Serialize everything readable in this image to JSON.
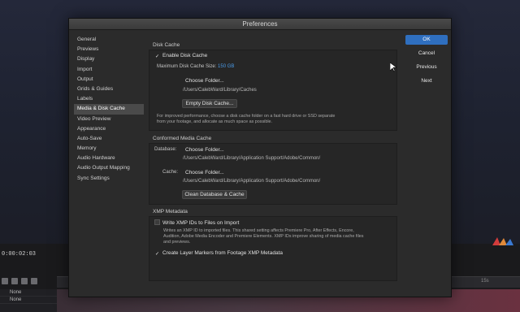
{
  "dialog": {
    "title": "Preferences"
  },
  "sidebar": {
    "items": [
      {
        "label": "General"
      },
      {
        "label": "Previews"
      },
      {
        "label": "Display"
      },
      {
        "label": "Import"
      },
      {
        "label": "Output"
      },
      {
        "label": "Grids & Guides"
      },
      {
        "label": "Labels"
      },
      {
        "label": "Media & Disk Cache"
      },
      {
        "label": "Video Preview"
      },
      {
        "label": "Appearance"
      },
      {
        "label": "Auto-Save"
      },
      {
        "label": "Memory"
      },
      {
        "label": "Audio Hardware"
      },
      {
        "label": "Audio Output Mapping"
      },
      {
        "label": "Sync Settings"
      }
    ],
    "active_index": 7
  },
  "disk_cache": {
    "title": "Disk Cache",
    "enable_label": "Enable Disk Cache",
    "max_size_label": "Maximum Disk Cache Size:",
    "max_size_value": "150 GB",
    "choose_folder": "Choose Folder...",
    "path": "/Users/CalebWard/Library/Caches",
    "empty_button": "Empty Disk Cache...",
    "note_line1": "For improved performance, choose a disk cache folder on a fast hard drive or SSD separate",
    "note_line2": "from your footage, and allocate as much space as possible."
  },
  "conformed_cache": {
    "title": "Conformed Media Cache",
    "database_label": "Database:",
    "database_choose": "Choose Folder...",
    "database_path": "/Users/CalebWard/Library/Application Support/Adobe/Common/",
    "cache_label": "Cache:",
    "cache_choose": "Choose Folder...",
    "cache_path": "/Users/CalebWard/Library/Application Support/Adobe/Common/",
    "clean_button": "Clean Database & Cache"
  },
  "xmp": {
    "title": "XMP Metadata",
    "write_label": "Write XMP IDs to Files on Import",
    "write_checked": false,
    "note_line1": "Writes an XMP ID to imported files. This shared setting affects Premiere Pro, After Effects, Encore,",
    "note_line2": "Audition, Adobe Media Encoder and Premiere Elements. XMP IDs improve sharing of media cache files",
    "note_line3": "and previews.",
    "markers_label": "Create Layer Markers from Footage XMP Metadata",
    "markers_checked": true
  },
  "buttons": {
    "ok": "OK",
    "cancel": "Cancel",
    "previous": "Previous",
    "next": "Next"
  },
  "background_app": {
    "timecode": "0:00:02:03",
    "ruler_label": "15s",
    "layer1_mode": "None",
    "layer2_mode": "None"
  },
  "icons": {
    "check": "checkmark-icon",
    "cursor": "mouse-pointer-icon"
  },
  "colors": {
    "primary_button": "#2f6fbf",
    "link_value": "#4a9be8",
    "dialog_bg": "#2b2b2b"
  }
}
